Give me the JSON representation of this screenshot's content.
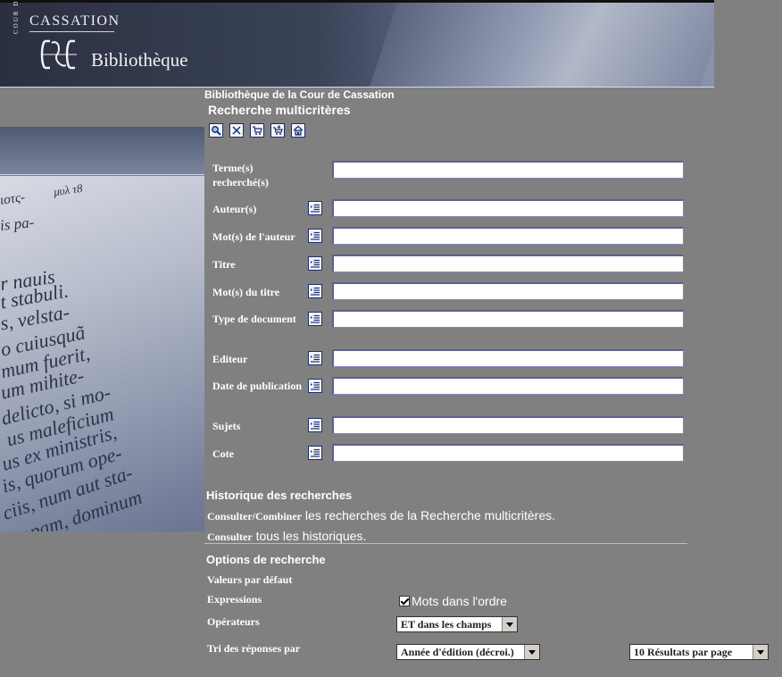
{
  "banner": {
    "vertical_label": "COUR DE",
    "cassation": "CASSATION",
    "bibliotheque": "Bibliothèque"
  },
  "header": {
    "site": "Bibliothèque de la Cour de Cassation",
    "title": "Recherche multicritères"
  },
  "toolbar": {
    "buttons": [
      {
        "icon": "search-icon"
      },
      {
        "icon": "clear-icon"
      },
      {
        "icon": "cart-icon"
      },
      {
        "icon": "cart-add-icon"
      },
      {
        "icon": "home-icon"
      }
    ]
  },
  "form": {
    "fields": [
      {
        "label": "Terme(s) recherché(s)",
        "value": "",
        "has_index": false
      },
      {
        "label": "Auteur(s)",
        "value": "",
        "has_index": true
      },
      {
        "label": "Mot(s) de l'auteur",
        "value": "",
        "has_index": true
      },
      {
        "label": "Titre",
        "value": "",
        "has_index": true
      },
      {
        "label": "Mot(s) du titre",
        "value": "",
        "has_index": true
      },
      {
        "label": "Type de document",
        "value": "",
        "has_index": true
      },
      {
        "label": "Editeur",
        "value": "",
        "has_index": true
      },
      {
        "label": "Date de publication",
        "value": "",
        "has_index": true
      },
      {
        "label": "Sujets",
        "value": "",
        "has_index": true
      },
      {
        "label": "Cote",
        "value": "",
        "has_index": true
      }
    ]
  },
  "history": {
    "title": "Historique des recherches",
    "line1_link": "Consulter/Combiner",
    "line1_text": "les recherches de la Recherche multicritères.",
    "line2_link": "Consulter",
    "line2_text": "tous les historiques."
  },
  "options": {
    "title": "Options de recherche",
    "defaults_label": "Valeurs par défaut",
    "expressions_label": "Expressions",
    "expressions_checkbox": "Mots dans l'ordre",
    "expressions_checked": true,
    "operators_label": "Opérateurs",
    "operators_value": "ET dans les champs",
    "sort_label": "Tri des réponses par",
    "sort_value": "Année d'édition (décroi.)",
    "per_page_value": "10 Résultats par page"
  },
  "sidebar_image_text": [
    "ιοτς-",
    "μυλ τ8",
    "is pa-",
    "r nauis",
    "t stabuli.",
    "s, velsta-",
    "o cuiusquã",
    "mum fuerit,",
    "um mihite-",
    "delicto, si mo-",
    "us maleficium",
    "us ex ministris,",
    "is, quorum ope-",
    "ciis, num aut sta-",
    "opam, dominum"
  ]
}
